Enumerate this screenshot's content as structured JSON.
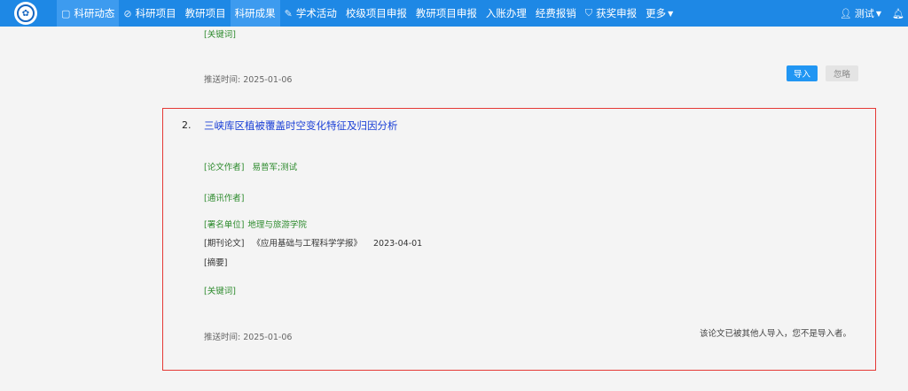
{
  "navbar": {
    "items": [
      {
        "label": "科研动态",
        "icon": "document-icon",
        "glyph": "▢",
        "active": true
      },
      {
        "label": "科研项目",
        "icon": "compass-icon",
        "glyph": "⊘",
        "active": false
      },
      {
        "label": "教研项目",
        "icon": "",
        "glyph": "",
        "active": false
      },
      {
        "label": "科研成果",
        "icon": "",
        "glyph": "",
        "active": true
      },
      {
        "label": "学术活动",
        "icon": "edit-icon",
        "glyph": "✎",
        "active": false
      },
      {
        "label": "校级项目申报",
        "icon": "",
        "glyph": "",
        "active": false
      },
      {
        "label": "教研项目申报",
        "icon": "",
        "glyph": "",
        "active": false
      },
      {
        "label": "入账办理",
        "icon": "",
        "glyph": "",
        "active": false
      },
      {
        "label": "经费报销",
        "icon": "",
        "glyph": "",
        "active": false
      },
      {
        "label": "获奖申报",
        "icon": "mortarboard-icon",
        "glyph": "⛉",
        "active": false
      },
      {
        "label": "更多",
        "icon": "",
        "glyph": "",
        "active": false,
        "dropdown": true
      }
    ],
    "user": "测试",
    "user_icon": "user-icon",
    "bell_icon": "bell-icon"
  },
  "previous_item": {
    "keywords_label": "[关键词]",
    "push_time": "推送时间:  2025-01-06",
    "import_label": "导入",
    "ignore_label": "忽略"
  },
  "item": {
    "number": "2.",
    "title": "三峡库区植被覆盖时空变化特征及归因分析",
    "author_label": "[论文作者]",
    "authors": "易普军;测试",
    "corresponding_label": "[通讯作者]",
    "affiliation_label": "[署名单位]",
    "affiliation": "地理与旅游学院",
    "journal_label": "[期刊论文]",
    "journal": "《应用基础与工程科学学报》",
    "date": "2023-04-01",
    "abstract_label": "[摘要]",
    "keywords_label": "[关键词]",
    "push_time": "推送时间:  2025-01-06",
    "notice": "该论文已被其他人导入，您不是导入者。"
  },
  "colors": {
    "nav": "#1e88e5",
    "active_tab": "#3d9bef",
    "highlight_border": "#e53935",
    "label_green": "#2e8b2e",
    "title_blue": "#1a3fd6"
  }
}
